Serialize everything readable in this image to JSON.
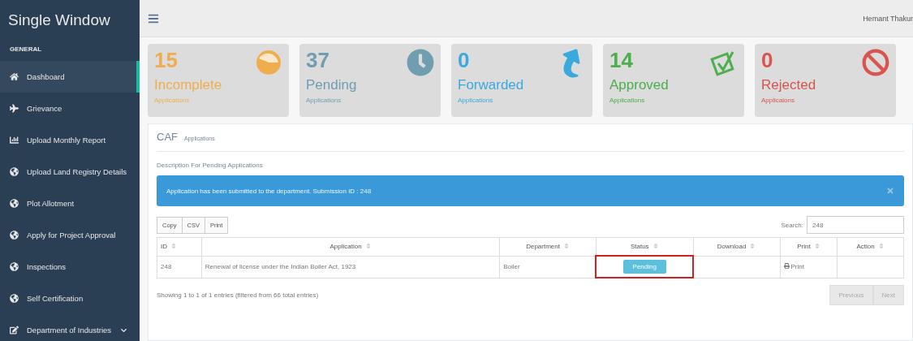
{
  "sidebar": {
    "title": "Single Window",
    "section": "GENERAL",
    "items": [
      {
        "label": "Dashboard",
        "kind": "home",
        "selected": true,
        "expandable": false
      },
      {
        "label": "Grievance",
        "kind": "plane",
        "selected": false,
        "expandable": false
      },
      {
        "label": "Upload Monthly Report",
        "kind": "chart",
        "selected": false,
        "expandable": false
      },
      {
        "label": "Upload Land Registry Details",
        "kind": "globe",
        "selected": false,
        "expandable": false
      },
      {
        "label": "Plot Allotment",
        "kind": "globe",
        "selected": false,
        "expandable": false
      },
      {
        "label": "Apply for Project Approval",
        "kind": "globe",
        "selected": false,
        "expandable": false
      },
      {
        "label": "Inspections",
        "kind": "globe",
        "selected": false,
        "expandable": false
      },
      {
        "label": "Self Certification",
        "kind": "globe",
        "selected": false,
        "expandable": false
      },
      {
        "label": "Department of Industries",
        "kind": "edit",
        "selected": false,
        "expandable": true
      }
    ]
  },
  "topbar": {
    "user": "Hemant Thakur"
  },
  "stats": [
    {
      "count": "15",
      "label": "Incomplete",
      "sub": "Applications",
      "kind": "pie",
      "color": "#f0ad4e"
    },
    {
      "count": "37",
      "label": "Pending",
      "sub": "Applications",
      "kind": "clock",
      "color": "#6f9eb0"
    },
    {
      "count": "0",
      "label": "Forwarded",
      "sub": "Applications",
      "kind": "forward",
      "color": "#3aa9dc"
    },
    {
      "count": "14",
      "label": "Approved",
      "sub": "Applications",
      "kind": "check",
      "color": "#4cae4c"
    },
    {
      "count": "0",
      "label": "Rejected",
      "sub": "Applicaions",
      "kind": "ban",
      "color": "#d9534f"
    }
  ],
  "panel": {
    "title": "CAF",
    "subtitle": "Applications",
    "description": "Description For Pending Applications",
    "alert": "Application has been submitted to the department. Submission ID : 248",
    "buttons": [
      "Copy",
      "CSV",
      "Print"
    ],
    "search_label": "Search:",
    "search_value": "248",
    "table": {
      "columns": [
        {
          "label": "ID",
          "sortable": true
        },
        {
          "label": "Application",
          "sortable": true
        },
        {
          "label": "Department",
          "sortable": true
        },
        {
          "label": "Status",
          "sortable": true
        },
        {
          "label": "Download",
          "sortable": true
        },
        {
          "label": "Print",
          "sortable": true
        },
        {
          "label": "Action",
          "sortable": true
        }
      ],
      "rows": [
        {
          "id": "248",
          "application": "Renewal of license under the Indian Boiler Act, 1923",
          "department": "Boiler",
          "status": "Pending",
          "status_highlighted": true,
          "print": "Print"
        }
      ]
    },
    "info": "Showing 1 to 1 of 1 entries (filtered from 66 total entries)",
    "pagination": [
      {
        "label": "Previous",
        "disabled": true
      },
      {
        "label": "Next",
        "disabled": true
      }
    ]
  }
}
